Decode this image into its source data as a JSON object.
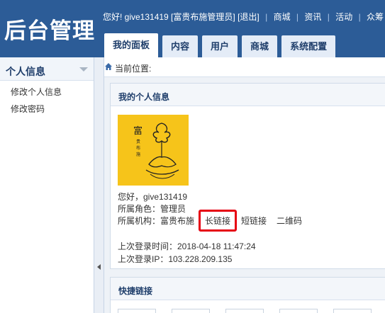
{
  "header": {
    "logo": "后台管理",
    "greeting": "您好! give131419 [富贵布施管理员]",
    "logout": "[退出]",
    "links": [
      "商城",
      "资讯",
      "活动",
      "众筹"
    ]
  },
  "tabs": [
    {
      "label": "我的面板",
      "active": true
    },
    {
      "label": "内容",
      "active": false
    },
    {
      "label": "用户",
      "active": false
    },
    {
      "label": "商城",
      "active": false
    },
    {
      "label": "系统配置",
      "active": false
    }
  ],
  "sidebar": {
    "title": "个人信息",
    "items": [
      "修改个人信息",
      "修改密码"
    ]
  },
  "breadcrumb": {
    "label": "当前位置:"
  },
  "profile_panel": {
    "title": "我的个人信息",
    "hello": "您好，give131419",
    "role": "所属角色：管理员",
    "org": "所属机构：富贵布施",
    "long_link": "长链接",
    "short_link": "短链接",
    "qrcode": "二维码",
    "last_login_time": "上次登录时间：2018-04-18 11:47:24",
    "last_login_ip": "上次登录IP：103.228.209.135"
  },
  "quick_panel": {
    "title": "快捷链接"
  },
  "colors": {
    "header_bg": "#2c5c97",
    "highlight": "#e60012",
    "avatar_bg": "#f6c41a"
  }
}
